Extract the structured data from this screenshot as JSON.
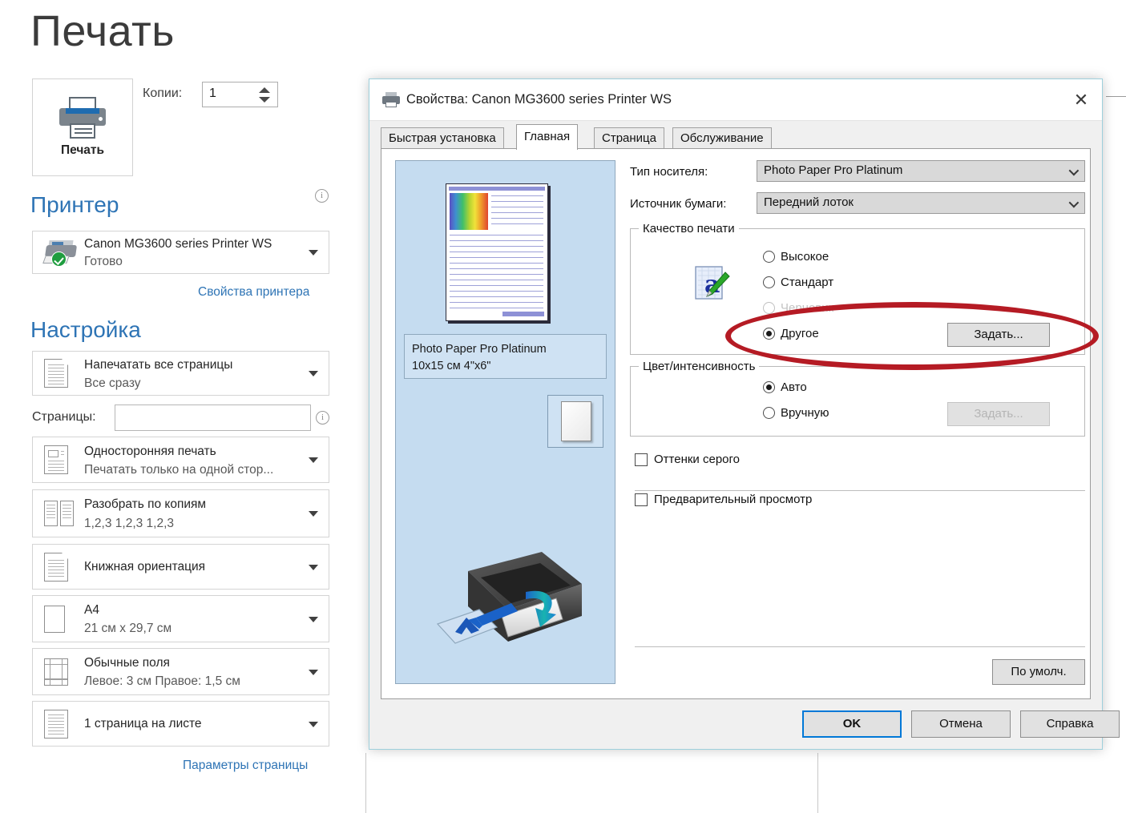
{
  "backstage": {
    "title": "Печать",
    "print_button_label": "Печать",
    "copies_label": "Копии:",
    "copies_value": "1",
    "printer_section_title": "Принтер",
    "printer_name": "Canon MG3600 series Printer WS",
    "printer_status": "Готово",
    "printer_properties_link": "Свойства принтера",
    "settings_section_title": "Настройка",
    "pages_label": "Страницы:",
    "pages_value": "",
    "page_setup_link": "Параметры страницы",
    "settings": [
      {
        "main": "Напечатать все страницы",
        "sub": "Все сразу",
        "icon": "document-icon"
      },
      {
        "main": "Односторонняя печать",
        "sub": "Печатать только на одной стор...",
        "icon": "one-sided-icon"
      },
      {
        "main": "Разобрать по копиям",
        "sub": "1,2,3   1,2,3   1,2,3",
        "icon": "collate-icon"
      },
      {
        "main": "Книжная ориентация",
        "sub": "",
        "icon": "portrait-icon"
      },
      {
        "main": "A4",
        "sub": "21 см x 29,7 см",
        "icon": "paper-size-icon"
      },
      {
        "main": "Обычные поля",
        "sub": "Левое:  3 см    Правое:  1,5 см",
        "icon": "margins-icon"
      },
      {
        "main": "1 страница на листе",
        "sub": "",
        "icon": "pages-per-sheet-icon"
      }
    ]
  },
  "dialog": {
    "title": "Свойства: Canon MG3600 series Printer WS",
    "close_label": "✕",
    "tabs": [
      {
        "label": "Быстрая установка",
        "active": false
      },
      {
        "label": "Главная",
        "active": true
      },
      {
        "label": "Страница",
        "active": false
      },
      {
        "label": "Обслуживание",
        "active": false
      }
    ],
    "preview": {
      "caption_line1": "Photo Paper Pro Platinum",
      "caption_line2": "10x15 см 4\"x6\""
    },
    "media_type_label": "Тип носителя:",
    "media_type_value": "Photo Paper Pro Platinum",
    "paper_source_label": "Источник бумаги:",
    "paper_source_value": "Передний лоток",
    "quality_group": {
      "title": "Качество печати",
      "options": [
        {
          "label": "Высокое",
          "checked": false,
          "disabled": false
        },
        {
          "label": "Стандарт",
          "checked": false,
          "disabled": false
        },
        {
          "label": "Черновик",
          "checked": false,
          "disabled": true
        },
        {
          "label": "Другое",
          "checked": true,
          "disabled": false
        }
      ],
      "set_button": "Задать..."
    },
    "color_group": {
      "title": "Цвет/интенсивность",
      "options": [
        {
          "label": "Авто",
          "checked": true
        },
        {
          "label": "Вручную",
          "checked": false
        }
      ],
      "set_button": "Задать...",
      "set_button_disabled": true
    },
    "grayscale_checkbox": {
      "label": "Оттенки серого",
      "checked": false
    },
    "preview_checkbox": {
      "label": "Предварительный просмотр",
      "checked": false
    },
    "defaults_button": "По умолч.",
    "footer_buttons": [
      {
        "label": "OK",
        "primary": true
      },
      {
        "label": "Отмена",
        "primary": false
      },
      {
        "label": "Справка",
        "primary": false
      }
    ]
  },
  "annotation": {
    "shape": "ellipse",
    "color": "#b51b24"
  }
}
